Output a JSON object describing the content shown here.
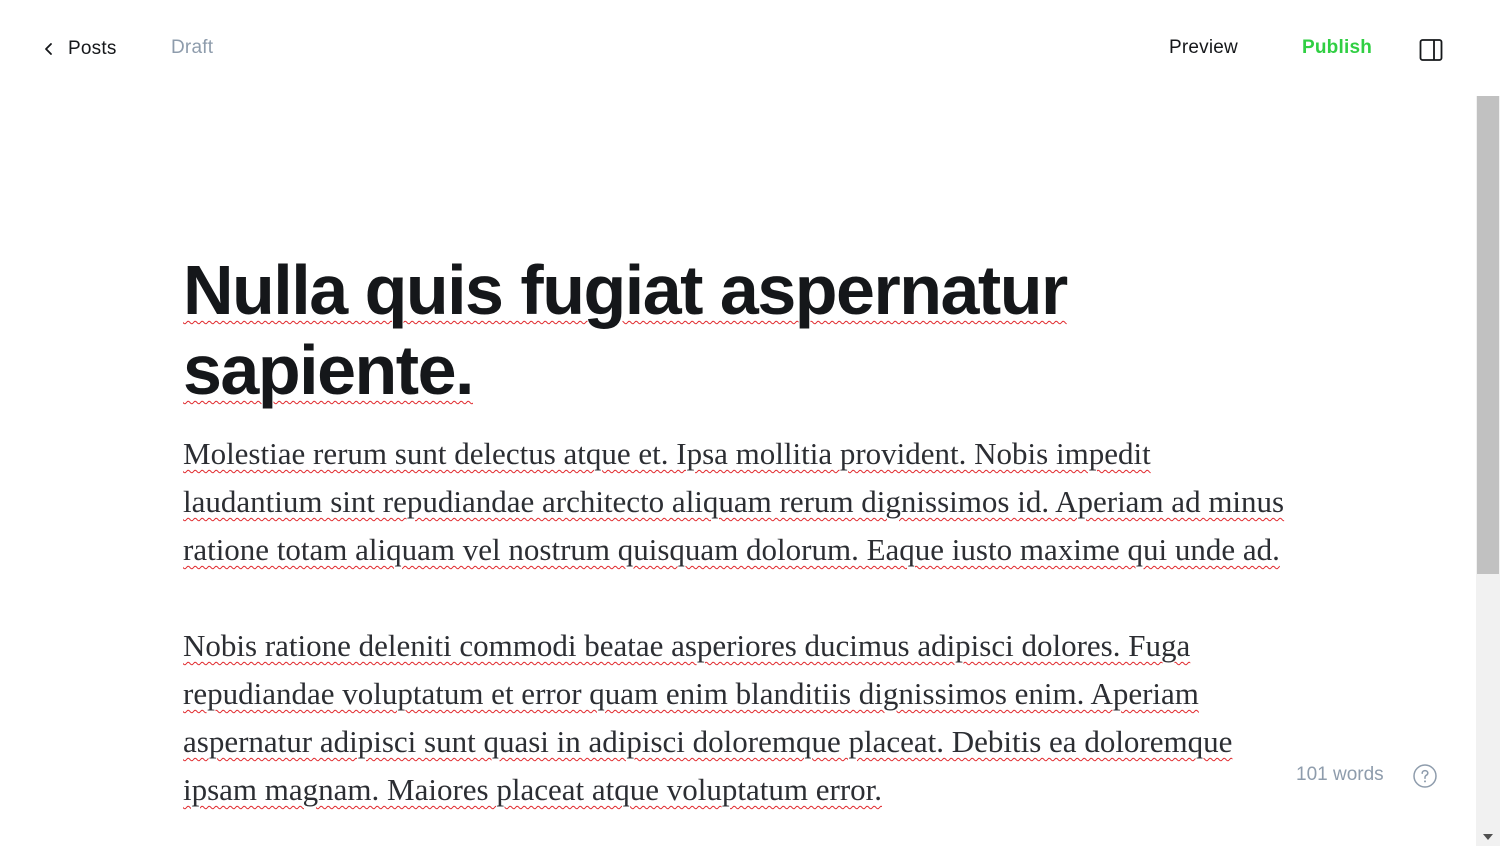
{
  "header": {
    "back_label": "Posts",
    "status": "Draft",
    "preview_label": "Preview",
    "publish_label": "Publish"
  },
  "post": {
    "title": "Nulla quis fugiat aspernatur sapiente.",
    "paragraphs": [
      "Molestiae rerum sunt delectus atque et. Ipsa mollitia provident. Nobis impedit laudantium sint repudiandae architecto aliquam rerum dignissimos id. Aperiam ad minus ratione totam aliquam vel nostrum quisquam dolorum. Eaque iusto maxime qui unde ad.",
      "Nobis ratione deleniti commodi beatae asperiores ducimus adipisci dolores. Fuga repudiandae voluptatum et error quam enim blanditiis dignissimos enim. Aperiam aspernatur adipisci sunt quasi in adipisci doloremque placeat. Debitis ea doloremque ipsam magnam. Maiores placeat atque voluptatum error."
    ]
  },
  "footer": {
    "word_count": "101 words"
  },
  "icons": {
    "back": "chevron-left-icon",
    "settings": "sidebar-toggle-icon",
    "help": "help-circle-icon"
  },
  "colors": {
    "text": "#15171a",
    "muted": "#8e9cac",
    "publish": "#30cf43",
    "spellcheck": "#e0262a"
  }
}
